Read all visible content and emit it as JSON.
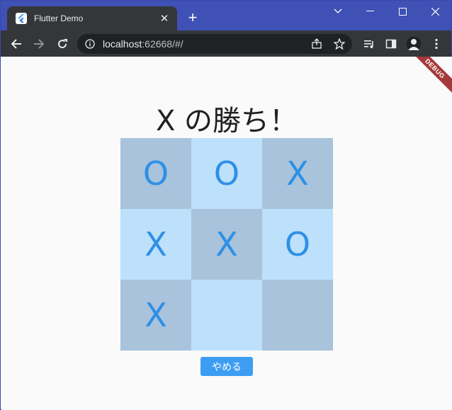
{
  "browser": {
    "tab_title": "Flutter Demo",
    "url_host": "localhost",
    "url_rest": ":62668/#/",
    "new_tab_label": "+",
    "close_label": "✕"
  },
  "page": {
    "debug_banner": "DEBUG",
    "title": "X の勝ち！",
    "board": [
      "O",
      "O",
      "X",
      "X",
      "X",
      "O",
      "X",
      "",
      ""
    ],
    "quit_label": "やめる"
  },
  "colors": {
    "cell_dark": "#a8c3db",
    "cell_light": "#bde0fb",
    "mark": "#2e8fe6",
    "button": "#3d9df2",
    "chrome_frame": "#3f51b5"
  }
}
